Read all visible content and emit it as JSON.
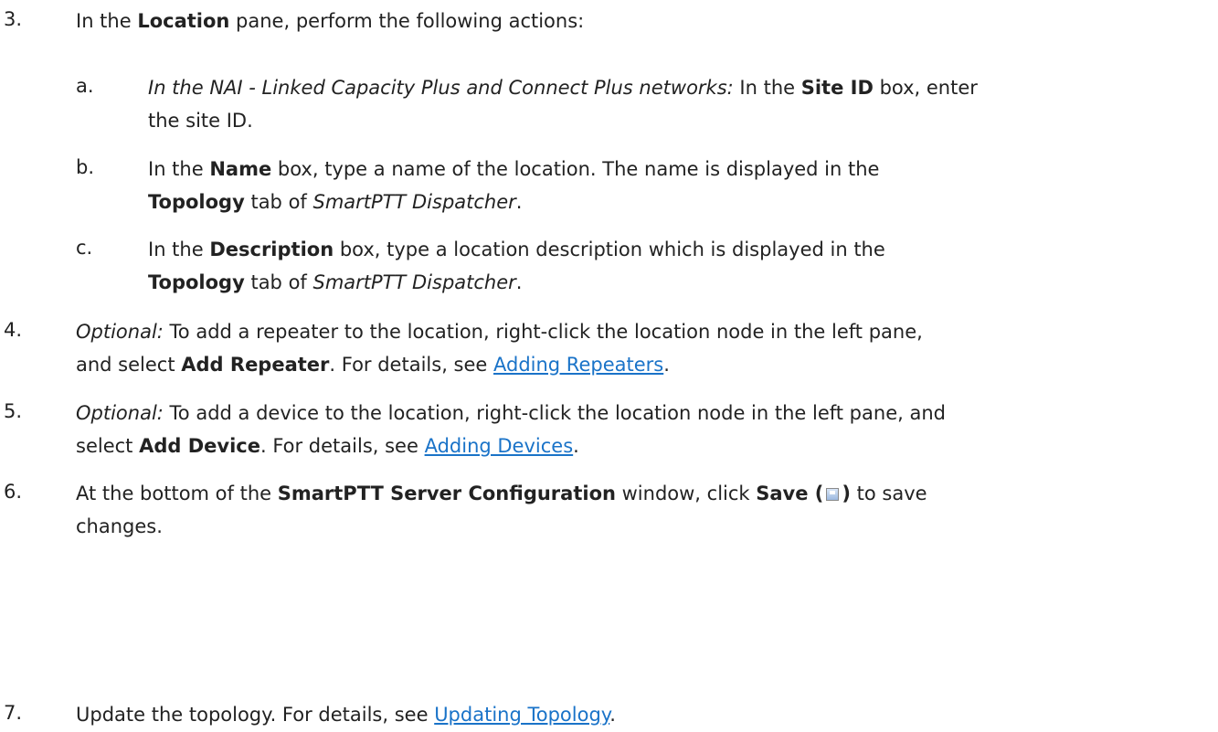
{
  "steps": {
    "s3": {
      "num": "3.",
      "pre": "In the ",
      "b1": "Location",
      "post": " pane, perform the following actions:"
    },
    "sa": {
      "num": "a.",
      "it1": "In the NAI - Linked Capacity Plus and Connect Plus networks:",
      "t1": " In the ",
      "b1": "Site ID",
      "t2": " box, enter",
      "line2": "the site ID."
    },
    "sb": {
      "num": "b.",
      "t1": "In the ",
      "b1": "Name",
      "t2": " box, type a name of the location. The name is displayed in the",
      "b2": "Topology",
      "t3": " tab of ",
      "it1": "SmartPTT Dispatcher",
      "t4": "."
    },
    "sc": {
      "num": "c.",
      "t1": "In the ",
      "b1": "Description",
      "t2": " box, type a location description which is displayed in the",
      "b2": "Topology",
      "t3": " tab of ",
      "it1": "SmartPTT Dispatcher",
      "t4": "."
    },
    "s4": {
      "num": "4.",
      "it1": "Optional:",
      "t1": " To add a repeater to the location, right-click the location node in the left pane,",
      "t2": "and select ",
      "b1": "Add Repeater",
      "t3": ". For details, see ",
      "link": "Adding Repeaters",
      "t4": "."
    },
    "s5": {
      "num": "5.",
      "it1": "Optional:",
      "t1": " To add a device to the location, right-click the location node in the left pane, and",
      "t2": "select ",
      "b1": "Add Device",
      "t3": ". For details, see ",
      "link": "Adding Devices",
      "t4": "."
    },
    "s6": {
      "num": "6.",
      "t1": "At the bottom of the ",
      "b1": "SmartPTT Server Configuration",
      "t2": " window, click ",
      "b2a": "Save (",
      "b2b": ")",
      "t3": " to save",
      "line2": "changes.",
      "icon": "save-icon"
    },
    "s7": {
      "num": "7.",
      "t1": "Update the topology. For details, see ",
      "link": "Updating Topology",
      "t2": "."
    }
  },
  "colors": {
    "text": "#222222",
    "link": "#1a73c8"
  }
}
